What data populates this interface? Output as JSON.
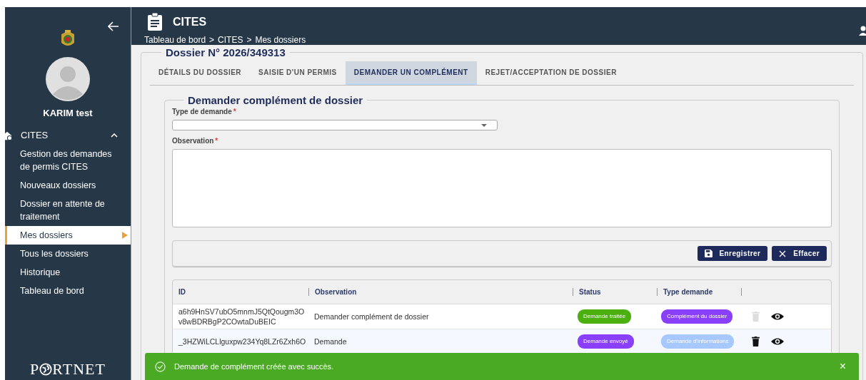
{
  "sidebar": {
    "user_name": "KARIM test",
    "section": {
      "label": "CITES",
      "expanded": true
    },
    "items": [
      {
        "label": "Gestion des demandes de permis CITES",
        "selected": false
      },
      {
        "label": "Nouveaux dossiers",
        "selected": false
      },
      {
        "label": "Dossier en attente de traitement",
        "selected": false
      },
      {
        "label": "Mes dossiers",
        "selected": true
      },
      {
        "label": "Tous les dossiers",
        "selected": false
      },
      {
        "label": "Historique",
        "selected": false
      },
      {
        "label": "Tableau de bord",
        "selected": false
      }
    ],
    "logo": {
      "before": "P",
      "after": "RTNET"
    }
  },
  "header": {
    "title": "CITES",
    "breadcrumb": [
      "Tableau de bord",
      "CITES",
      "Mes dossiers"
    ],
    "separator": ">"
  },
  "dossier": {
    "title": "Dossier N° 2026/349313",
    "tabs": [
      {
        "label": "DÉTAILS DU DOSSIER",
        "selected": false
      },
      {
        "label": "SAISIE D'UN PERMIS",
        "selected": false
      },
      {
        "label": "DEMANDER UN COMPLÉMENT",
        "selected": true
      },
      {
        "label": "REJET/ACCEPTATION DE DOSSIER",
        "selected": false
      }
    ],
    "form": {
      "title": "Demander complément de dossier",
      "type_field": {
        "label": "Type de demande",
        "required_mark": "*"
      },
      "observation_field": {
        "label": "Observation",
        "required_mark": "*"
      },
      "buttons": [
        {
          "kind": "save",
          "label": "Enregistrer"
        },
        {
          "kind": "clear",
          "label": "Effacer"
        }
      ]
    },
    "table": {
      "columns": [
        "ID",
        "Observation",
        "Status",
        "Type demande"
      ],
      "rows": [
        {
          "id": [
            "a6h9HnSV7ubO5mnmJ5QtQougm3O",
            "v8wBDRBgP2COwtaDuBEIC"
          ],
          "observation": "Demander complément de dossier",
          "status": {
            "label": "Demande traitée",
            "color": "#4caf10"
          },
          "type": {
            "label": "Complément du dossier",
            "color": "#8a3ffc"
          },
          "delete_disabled": true
        },
        {
          "id": [
            "_3HZWiLCLlguxpw234Yq8LZr6Zxh6O"
          ],
          "observation": "Demande",
          "status": {
            "label": "Demande envoyé",
            "color": "#8a3ffc"
          },
          "type": {
            "label": "Demande d'informations",
            "color": "#a6c8ff"
          },
          "delete_disabled": false
        }
      ]
    }
  },
  "toast": {
    "message": "Demande de complément créée avec succès.",
    "close": "×"
  }
}
